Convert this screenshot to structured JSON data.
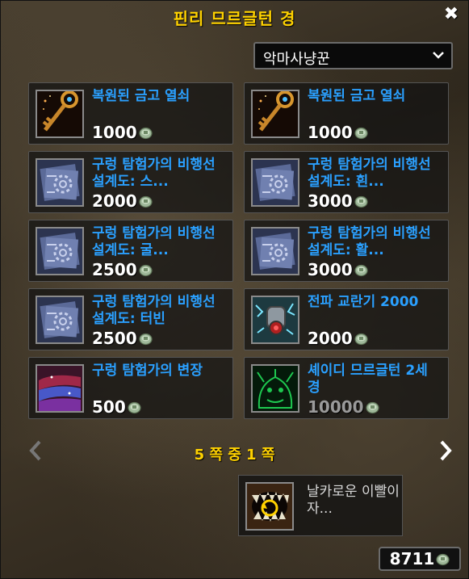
{
  "window": {
    "title": "핀리 므르글턴 경"
  },
  "filter": {
    "selected": "악마사냥꾼"
  },
  "items": [
    {
      "name": "복원된 금고 열쇠",
      "price": "1000",
      "icon": "golden-key-icon",
      "affordable": true
    },
    {
      "name": "복원된 금고 열쇠",
      "price": "1000",
      "icon": "golden-key-icon",
      "affordable": true
    },
    {
      "name": "구렁 탐험가의 비행선 설계도: 스...",
      "price": "2000",
      "icon": "blueprint-icon",
      "affordable": true
    },
    {
      "name": "구렁 탐험가의 비행선 설계도: 흰...",
      "price": "3000",
      "icon": "blueprint-icon",
      "affordable": true
    },
    {
      "name": "구렁 탐험가의 비행선 설계도: 굴...",
      "price": "2500",
      "icon": "blueprint-icon",
      "affordable": true
    },
    {
      "name": "구렁 탐험가의 비행선 설계도: 활...",
      "price": "3000",
      "icon": "blueprint-icon",
      "affordable": true
    },
    {
      "name": "구렁 탐험가의 비행선 설계도: 터빈",
      "price": "2500",
      "icon": "blueprint-icon",
      "affordable": true
    },
    {
      "name": "전파 교란기 2000",
      "price": "2000",
      "icon": "signal-jammer-icon",
      "affordable": true
    },
    {
      "name": "구렁 탐험가의 변장",
      "price": "500",
      "icon": "disguise-cloth-icon",
      "affordable": true
    },
    {
      "name": "셰이디 므르글턴 2세 경",
      "price": "10000",
      "icon": "murloc-pet-icon",
      "affordable": false
    }
  ],
  "pager": {
    "text": "5 쪽 중 1 쪽"
  },
  "buyback": {
    "name": "날카로운 이빨이 자...",
    "icon": "sharp-teeth-icon"
  },
  "currency": {
    "amount": "8711",
    "icon": "coin-icon"
  },
  "colors": {
    "title": "#ffd200",
    "item_name": "#2aa0ff",
    "price": "#ffffff",
    "price_unaffordable": "#9a9a9a"
  }
}
